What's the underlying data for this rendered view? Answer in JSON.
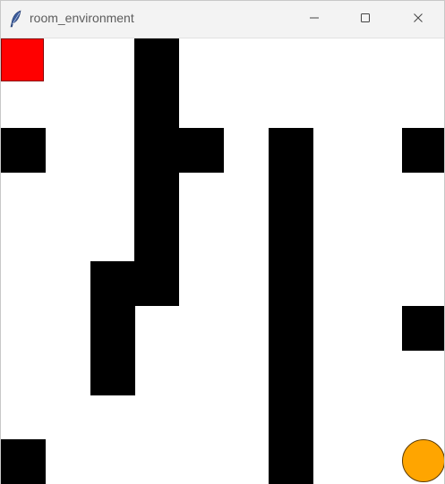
{
  "window": {
    "title": "room_environment",
    "app_icon": "feather-icon",
    "controls": {
      "minimize_icon": "minimize-icon",
      "maximize_icon": "maximize-icon",
      "close_icon": "close-icon"
    }
  },
  "environment": {
    "grid_size": 10,
    "agent": {
      "row": 0,
      "col": 0,
      "color": "#ff0000"
    },
    "goal": {
      "row": 9,
      "col": 9,
      "color": "#ffa500"
    },
    "walls": [
      {
        "row": 0,
        "col": 3
      },
      {
        "row": 1,
        "col": 3
      },
      {
        "row": 2,
        "col": 0
      },
      {
        "row": 2,
        "col": 3
      },
      {
        "row": 2,
        "col": 4
      },
      {
        "row": 2,
        "col": 6
      },
      {
        "row": 2,
        "col": 9
      },
      {
        "row": 3,
        "col": 3
      },
      {
        "row": 3,
        "col": 6
      },
      {
        "row": 4,
        "col": 3
      },
      {
        "row": 4,
        "col": 6
      },
      {
        "row": 5,
        "col": 2
      },
      {
        "row": 5,
        "col": 3
      },
      {
        "row": 5,
        "col": 6
      },
      {
        "row": 6,
        "col": 2
      },
      {
        "row": 6,
        "col": 6
      },
      {
        "row": 6,
        "col": 9
      },
      {
        "row": 7,
        "col": 2
      },
      {
        "row": 7,
        "col": 6
      },
      {
        "row": 8,
        "col": 6
      },
      {
        "row": 9,
        "col": 0
      },
      {
        "row": 9,
        "col": 6
      }
    ],
    "colors": {
      "wall": "#000000",
      "floor": "#ffffff"
    }
  }
}
